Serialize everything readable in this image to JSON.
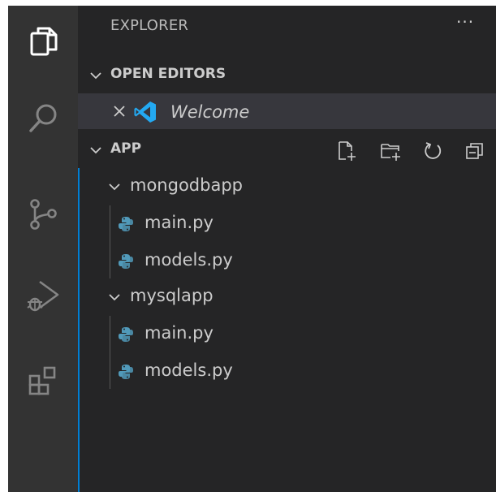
{
  "explorer": {
    "title": "EXPLORER",
    "more_actions": "···"
  },
  "open_editors": {
    "header": "OPEN EDITORS",
    "items": [
      {
        "label": "Welcome",
        "icon": "vscode-logo-icon"
      }
    ]
  },
  "app": {
    "header": "APP",
    "actions": [
      "new-file-icon",
      "new-folder-icon",
      "refresh-icon",
      "collapse-all-icon"
    ],
    "folders": [
      {
        "name": "mongodbapp",
        "files": [
          "main.py",
          "models.py"
        ]
      },
      {
        "name": "mysqlapp",
        "files": [
          "main.py",
          "models.py"
        ]
      }
    ]
  },
  "activity_bar": [
    "explorer-icon",
    "search-icon",
    "source-control-icon",
    "run-debug-icon",
    "extensions-icon"
  ],
  "colors": {
    "activity_bar_bg": "#333333",
    "sidebar_bg": "#252526",
    "selected_row_bg": "#37373d",
    "focus_border": "#007fd4",
    "python_icon": "#519aba",
    "vscode_blue": "#23a9f2"
  }
}
